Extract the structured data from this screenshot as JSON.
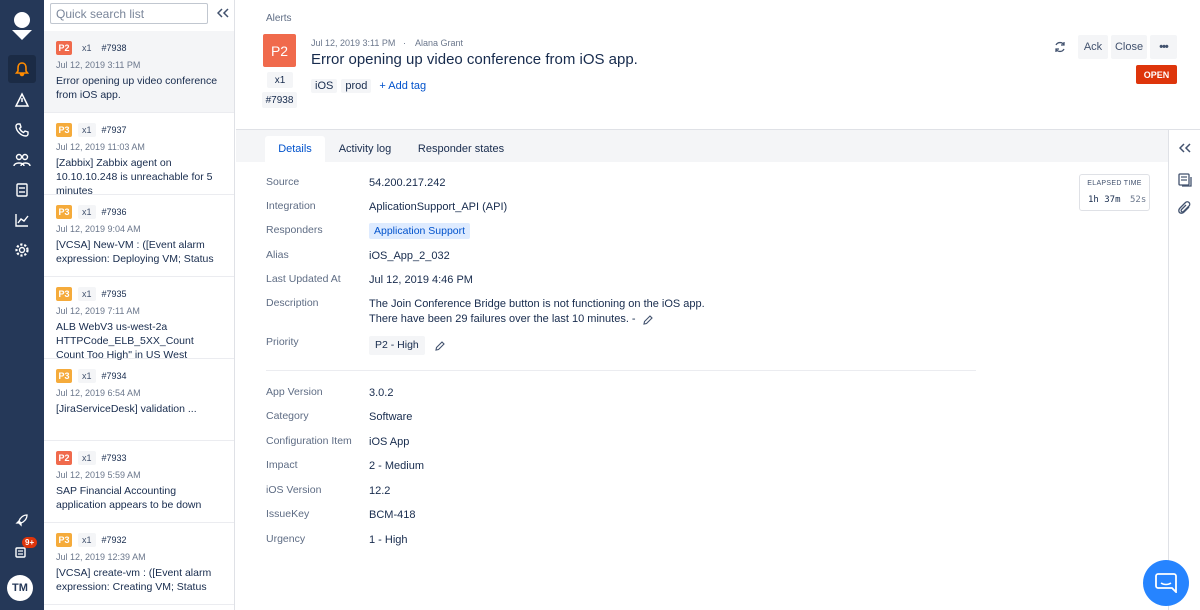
{
  "nav": {
    "items": [
      "logo-icon",
      "bell-icon",
      "alerts-list-icon",
      "on-call-icon",
      "teams-icon",
      "services-icon",
      "analytics-icon",
      "settings-icon"
    ],
    "bottom_items": [
      "rocket-icon",
      "notifications-icon"
    ],
    "notification_badge": "9+",
    "avatar": "TM"
  },
  "list": {
    "search_placeholder": "Quick search list",
    "items": [
      {
        "priority": "P2",
        "count": "x1",
        "id": "#7938",
        "date": "Jul 12, 2019 3:11 PM",
        "title": "Error opening up video conference from iOS app."
      },
      {
        "priority": "P3",
        "count": "x1",
        "id": "#7937",
        "date": "Jul 12, 2019 11:03 AM",
        "title": "[Zabbix] Zabbix agent on 10.10.10.248 is unreachable for 5 minutes"
      },
      {
        "priority": "P3",
        "count": "x1",
        "id": "#7936",
        "date": "Jul 12, 2019 9:04 AM",
        "title": "[VCSA] New-VM : ([Event alarm expression: Deploying VM; Status"
      },
      {
        "priority": "P3",
        "count": "x1",
        "id": "#7935",
        "date": "Jul 12, 2019 7:11 AM",
        "title": "ALB WebV3 us-west-2a HTTPCode_ELB_5XX_Count Count Too High\" in US West (Oregon)."
      },
      {
        "priority": "P3",
        "count": "x1",
        "id": "#7934",
        "date": "Jul 12, 2019 6:54 AM",
        "title": "[JiraServiceDesk] validation ..."
      },
      {
        "priority": "P2",
        "count": "x1",
        "id": "#7933",
        "date": "Jul 12, 2019 5:59 AM",
        "title": "SAP Financial Accounting application appears to be down"
      },
      {
        "priority": "P3",
        "count": "x1",
        "id": "#7932",
        "date": "Jul 12, 2019 12:39 AM",
        "title": "[VCSA] create-vm : ([Event alarm expression: Creating VM; Status"
      }
    ]
  },
  "header": {
    "breadcrumb": "Alerts",
    "priority": "P2",
    "count": "x1",
    "id": "#7938",
    "date": "Jul 12, 2019 3:11 PM",
    "separator": "·",
    "user": "Alana Grant",
    "title": "Error opening up video conference from iOS app.",
    "tags": [
      "iOS",
      "prod"
    ],
    "add_tag": "+ Add tag",
    "ack_label": "Ack",
    "close_label": "Close",
    "more_label": "•••",
    "status": "OPEN"
  },
  "tabs": [
    "Details",
    "Activity log",
    "Responder states"
  ],
  "details": {
    "source": {
      "label": "Source",
      "value": "54.200.217.242"
    },
    "integration": {
      "label": "Integration",
      "value": "AplicationSupport_API (API)"
    },
    "responders": {
      "label": "Responders",
      "value": "Application Support"
    },
    "alias": {
      "label": "Alias",
      "value": "iOS_App_2_032"
    },
    "last_updated": {
      "label": "Last Updated At",
      "value": "Jul 12, 2019 4:46 PM"
    },
    "description": {
      "label": "Description",
      "line1": "The Join Conference Bridge button is not functioning on the iOS app.",
      "line2": "There have been 29 failures over the last 10 minutes. -"
    },
    "priority": {
      "label": "Priority",
      "value": "P2 - High"
    }
  },
  "extra_fields": [
    {
      "label": "App Version",
      "value": "3.0.2"
    },
    {
      "label": "Category",
      "value": "Software"
    },
    {
      "label": "Configuration Item",
      "value": "iOS App"
    },
    {
      "label": "Impact",
      "value": "2 - Medium"
    },
    {
      "label": "iOS Version",
      "value": "12.2"
    },
    {
      "label": "IssueKey",
      "value": "BCM-418"
    },
    {
      "label": "Urgency",
      "value": "1 - High"
    }
  ],
  "elapsed": {
    "label": "ELAPSED TIME",
    "time": "1h 37m",
    "seconds": "52s"
  },
  "colors": {
    "nav_bg": "#253858",
    "p2": "#f06a4c",
    "p3": "#f5ab3b",
    "open": "#de350b",
    "link": "#0052cc",
    "chat": "#2684ff"
  }
}
